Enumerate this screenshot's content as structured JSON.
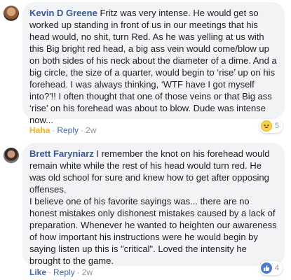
{
  "comments": [
    {
      "author": "Kevin D Greene",
      "text": " Fritz was very intense. He would get so worked up standing in front of us in our meetings that his head would, no shit, turn Red. As he was yelling at us with this Big bright red head, a big ass vein would come/blow up on both sides of his neck about the diameter of a dime. And a big circle, the size of a quarter, would begin to ‘rise’ up on his forehead. I was always thinking, ‘WTF have I got myself into?'!! I often thought that one of those veins or that Big ass ‘rise’ on his forehead was about to blow. Dude was intense now...",
      "reaction_label": "Haha",
      "reply_label": "Reply",
      "time": "2w",
      "reaction_icon": "haha-emoji-icon",
      "reaction_count": "5"
    },
    {
      "author": "Brett Faryniarz",
      "text": " I remember the knot on his forehead would remain white while the rest of his head would turn red. He was old school for sure and knew how to get after opposing offenses.\nI believe one of his favorite sayings was... there are no honest mistakes only dishonest mistakes caused by a lack of preparation. Whenever he wanted to heighten our awareness of how important his instructions were he would begin by saying listen up this is \"critical\". Loved the intensity he brought to the game.",
      "reaction_label": "Like",
      "reply_label": "Reply",
      "time": "2w",
      "reaction_icon": "like-thumb-icon",
      "reaction_count": "4"
    }
  ],
  "separator": "·",
  "colors": {
    "author_link": "#385898",
    "bubble_bg": "#f2f3f5",
    "haha": "#f7b125",
    "like": "#4267b2"
  }
}
